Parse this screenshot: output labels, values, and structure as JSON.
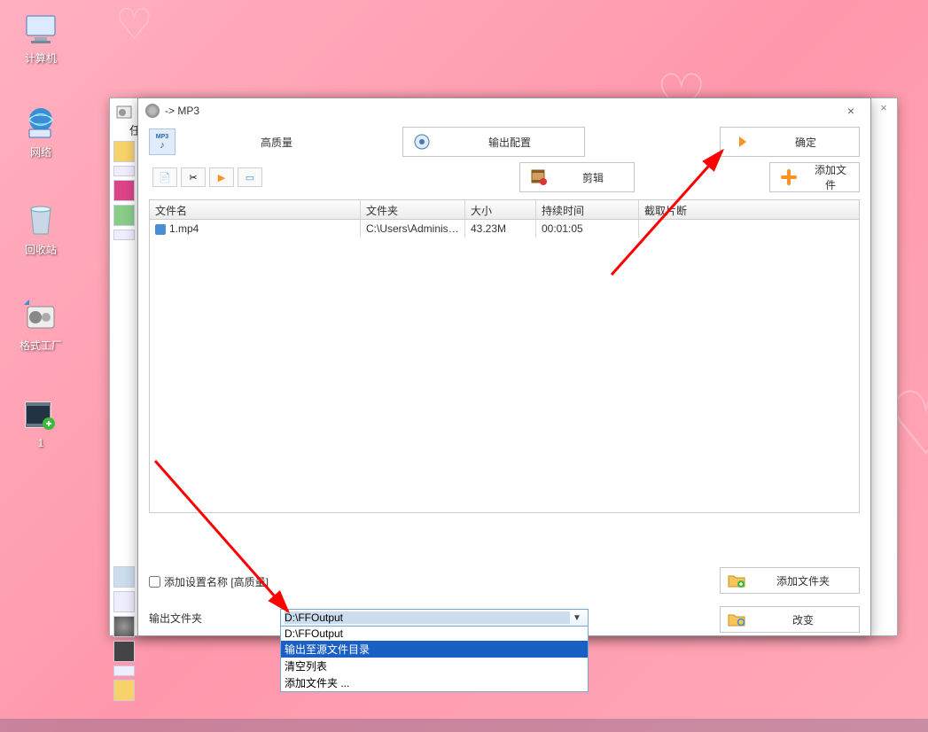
{
  "desktop": {
    "icons": [
      {
        "label": "计算机"
      },
      {
        "label": "网络"
      },
      {
        "label": "回收站"
      },
      {
        "label": "格式工厂"
      },
      {
        "label": "1"
      }
    ]
  },
  "parent_window": {
    "partial_text": "任"
  },
  "modal": {
    "title": "-> MP3",
    "quality_label": "高质量",
    "buttons": {
      "output_config": "输出配置",
      "confirm": "确定",
      "edit": "剪辑",
      "add_file": "添加文件",
      "add_folder": "添加文件夹",
      "change": "改变"
    },
    "checkbox_label": "添加设置名称 [高质量]",
    "file_table": {
      "headers": {
        "name": "文件名",
        "folder": "文件夹",
        "size": "大小",
        "duration": "持续时间",
        "clip": "截取片断"
      },
      "rows": [
        {
          "name": "1.mp4",
          "folder": "C:\\Users\\Administr...",
          "size": "43.23M",
          "duration": "00:01:05",
          "clip": ""
        }
      ]
    },
    "output_dir_label": "输出文件夹",
    "combo": {
      "value": "D:\\FFOutput",
      "options": [
        {
          "text": "D:\\FFOutput",
          "selected": false
        },
        {
          "text": "输出至源文件目录",
          "selected": true
        },
        {
          "text": "清空列表",
          "selected": false
        },
        {
          "text": "添加文件夹 ...",
          "selected": false
        }
      ]
    }
  }
}
